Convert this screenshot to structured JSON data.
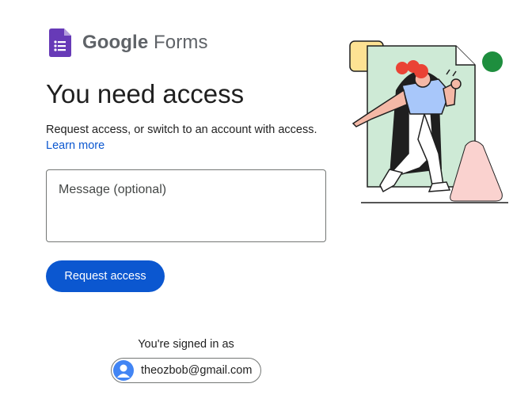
{
  "brand": {
    "google": "Google",
    "product": "Forms",
    "logo_icon": "google-forms-icon",
    "logo_color": "#673ab7"
  },
  "page": {
    "heading": "You need access",
    "description": "Request access, or switch to an account with access.",
    "learn_more": "Learn more"
  },
  "message": {
    "placeholder": "Message (optional)",
    "value": ""
  },
  "request_button": {
    "label": "Request access",
    "color": "#0b57d0"
  },
  "account": {
    "signed_in_label": "You're signed in as",
    "email": "theozbob@gmail.com",
    "avatar_icon": "person-avatar-icon"
  },
  "illustration": {
    "icon": "person-walking-through-document-illustration"
  },
  "colors": {
    "accent": "#0b57d0",
    "text": "#1f1f1f",
    "link": "#0b57d0"
  }
}
